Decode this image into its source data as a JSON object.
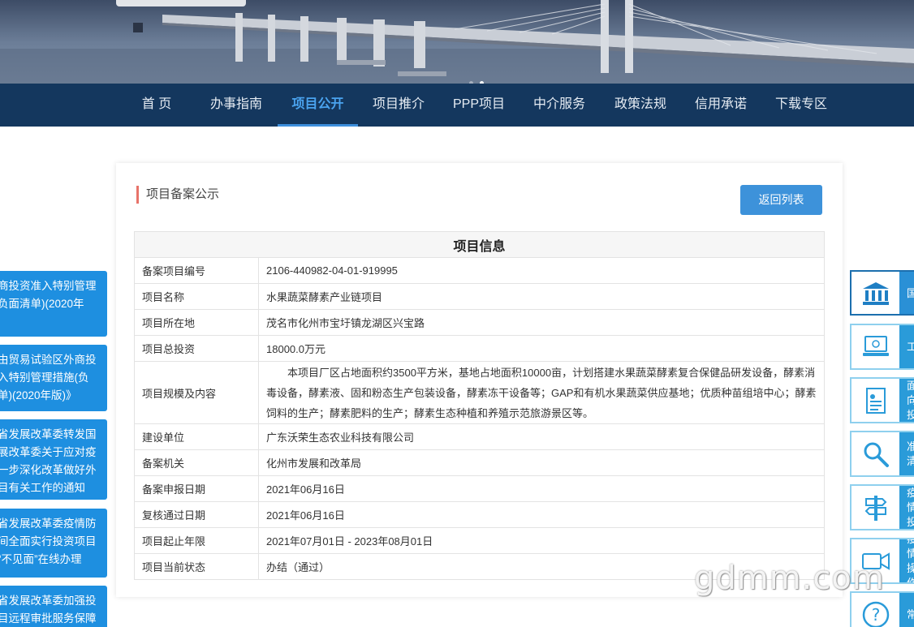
{
  "nav": {
    "items": [
      {
        "label": "首 页"
      },
      {
        "label": "办事指南"
      },
      {
        "label": "项目公开"
      },
      {
        "label": "项目推介"
      },
      {
        "label": "PPP项目"
      },
      {
        "label": "中介服务"
      },
      {
        "label": "政策法规"
      },
      {
        "label": "信用承诺"
      },
      {
        "label": "下载专区"
      }
    ],
    "active_index": 2,
    "colors": {
      "bar": "#14375e",
      "active": "#4aa3ef"
    }
  },
  "card": {
    "title": "项目备案公示",
    "back_button": "返回列表",
    "table_header": "项目信息",
    "rows": [
      {
        "label": "备案项目编号",
        "value": "2106-440982-04-01-919995"
      },
      {
        "label": "项目名称",
        "value": "水果蔬菜酵素产业链项目"
      },
      {
        "label": "项目所在地",
        "value": "茂名市化州市宝圩镇龙湖区兴宝路"
      },
      {
        "label": "项目总投资",
        "value": "18000.0万元"
      },
      {
        "label": "项目规模及内容",
        "value": "本项目厂区占地面积约3500平方米，基地占地面积10000亩，计划搭建水果蔬菜酵素复合保健品研发设备，酵素消毒设备，酵素液、固和粉态生产包装设备，酵素冻干设备等；GAP和有机水果蔬菜供应基地；优质种苗组培中心；酵素饲料的生产；酵素肥料的生产；酵素生态种植和养殖示范旅游景区等。"
      },
      {
        "label": "建设单位",
        "value": "广东沃荣生态农业科技有限公司"
      },
      {
        "label": "备案机关",
        "value": "化州市发展和改革局"
      },
      {
        "label": "备案申报日期",
        "value": "2021年06月16日"
      },
      {
        "label": "复核通过日期",
        "value": "2021年06月16日"
      },
      {
        "label": "项目起止年限",
        "value": "2021年07月01日 - 2023年08月01日"
      },
      {
        "label": "项目当前状态",
        "value": "办结（通过）"
      }
    ]
  },
  "left_notes": [
    {
      "lines": [
        "商投资准入特别管理",
        "负面清单)(2020年",
        ""
      ]
    },
    {
      "lines": [
        "由贸易试验区外商投",
        "入特别管理措施(负",
        "单)(2020年版)》"
      ]
    },
    {
      "lines": [
        "省发展改革委转发国",
        "展改革委关于应对疫",
        "一步深化改革做好外",
        "目有关工作的通知"
      ]
    },
    {
      "lines": [
        "省发展改革委疫情防",
        "间全面实行投资项目",
        "“不见面”在线办理"
      ]
    },
    {
      "lines": [
        "省发展改革委加强投",
        "目远程审批服务保障"
      ]
    }
  ],
  "right_buttons": [
    {
      "icon": "bank-icon",
      "lines": [
        "国"
      ]
    },
    {
      "icon": "computer-icon",
      "lines": [
        "工"
      ]
    },
    {
      "icon": "document-icon",
      "lines": [
        "面向",
        "投"
      ]
    },
    {
      "icon": "search-icon",
      "lines": [
        "准",
        "清"
      ]
    },
    {
      "icon": "signpost-icon",
      "lines": [
        "疫情",
        "投"
      ]
    },
    {
      "icon": "video-camera-icon",
      "lines": [
        "疫情",
        "操作"
      ]
    },
    {
      "icon": "question-icon",
      "lines": [
        "常"
      ]
    }
  ],
  "watermark": "gdmm.com"
}
